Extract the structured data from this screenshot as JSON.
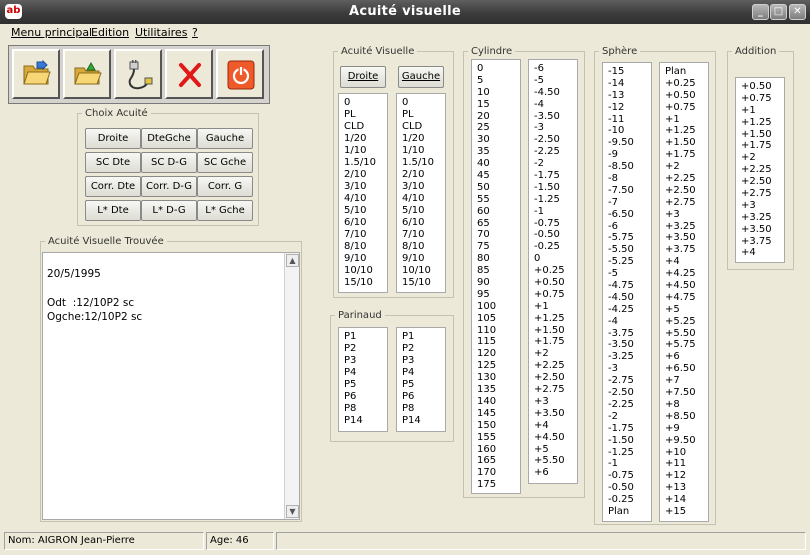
{
  "window": {
    "title": "Acuité visuelle",
    "app_icon_text": "ab"
  },
  "controls": {
    "minimize": "_",
    "maximize": "□",
    "close": "✕"
  },
  "menu": [
    "Menu principal",
    "Edition",
    "Utilitaires",
    "?"
  ],
  "toolbar": {
    "buttons": [
      {
        "name": "open-folder-button",
        "icon": "open-folder-icon"
      },
      {
        "name": "open-folder-2-button",
        "icon": "open-folder-green-icon"
      },
      {
        "name": "connect-device-button",
        "icon": "cable-plug-icon"
      },
      {
        "name": "delete-button",
        "icon": "red-x-icon"
      },
      {
        "name": "power-button",
        "icon": "power-icon"
      }
    ]
  },
  "choix_acuite": {
    "legend": "Choix Acuité",
    "buttons": [
      [
        "Droite",
        "DteGche",
        "Gauche"
      ],
      [
        "SC Dte",
        "SC D-G",
        "SC Gche"
      ],
      [
        "Corr. Dte",
        "Corr. D-G",
        "Corr. G"
      ],
      [
        "L* Dte",
        "L* D-G",
        "L* Gche"
      ]
    ]
  },
  "acuite_trouvee": {
    "legend": "Acuité Visuelle Trouvée",
    "text": "20/5/1995\n\nOdt  :12/10P2 sc\nOgche:12/10P2 sc"
  },
  "acuite_visuelle": {
    "legend": "Acuité Visuelle",
    "droite_label": "Droite",
    "gauche_label": "Gauche",
    "left_list": [
      "0",
      "PL",
      "CLD",
      "1/20",
      "1/10",
      "1.5/10",
      "2/10",
      "3/10",
      "4/10",
      "5/10",
      "6/10",
      "7/10",
      "8/10",
      "9/10",
      "10/10",
      "15/10"
    ],
    "right_list": [
      "0",
      "PL",
      "CLD",
      "1/20",
      "1/10",
      "1.5/10",
      "2/10",
      "3/10",
      "4/10",
      "5/10",
      "6/10",
      "7/10",
      "8/10",
      "9/10",
      "10/10",
      "15/10"
    ]
  },
  "parinaud": {
    "legend": "Parinaud",
    "left_list": [
      "P1",
      "P2",
      "P3",
      "P4",
      "P5",
      "P6",
      "P8",
      "P14"
    ],
    "right_list": [
      "P1",
      "P2",
      "P3",
      "P4",
      "P5",
      "P6",
      "P8",
      "P14"
    ]
  },
  "cylindre": {
    "legend": "Cylindre",
    "axis_list": [
      "0",
      "5",
      "10",
      "15",
      "20",
      "25",
      "30",
      "35",
      "40",
      "45",
      "50",
      "55",
      "60",
      "65",
      "70",
      "75",
      "80",
      "85",
      "90",
      "95",
      "100",
      "105",
      "110",
      "115",
      "120",
      "125",
      "130",
      "135",
      "140",
      "145",
      "150",
      "155",
      "160",
      "165",
      "170",
      "175"
    ],
    "power_list": [
      "-6",
      "-5",
      "-4.50",
      "-4",
      "-3.50",
      "-3",
      "-2.50",
      "-2.25",
      "-2",
      "-1.75",
      "-1.50",
      "-1.25",
      "-1",
      "-0.75",
      "-0.50",
      "-0.25",
      "0",
      "+0.25",
      "+0.50",
      "+0.75",
      "+1",
      "+1.25",
      "+1.50",
      "+1.75",
      "+2",
      "+2.25",
      "+2.50",
      "+2.75",
      "+3",
      "+3.50",
      "+4",
      "+4.50",
      "+5",
      "+5.50",
      "+6"
    ]
  },
  "sphere": {
    "legend": "Sphère",
    "minus_list": [
      "-15",
      "-14",
      "-13",
      "-12",
      "-11",
      "-10",
      "-9.50",
      "-9",
      "-8.50",
      "-8",
      "-7.50",
      "-7",
      "-6.50",
      "-6",
      "-5.75",
      "-5.50",
      "-5.25",
      "-5",
      "-4.75",
      "-4.50",
      "-4.25",
      "-4",
      "-3.75",
      "-3.50",
      "-3.25",
      "-3",
      "-2.75",
      "-2.50",
      "-2.25",
      "-2",
      "-1.75",
      "-1.50",
      "-1.25",
      "-1",
      "-0.75",
      "-0.50",
      "-0.25",
      "Plan"
    ],
    "plus_list": [
      "Plan",
      "+0.25",
      "+0.50",
      "+0.75",
      "+1",
      "+1.25",
      "+1.50",
      "+1.75",
      "+2",
      "+2.25",
      "+2.50",
      "+2.75",
      "+3",
      "+3.25",
      "+3.50",
      "+3.75",
      "+4",
      "+4.25",
      "+4.50",
      "+4.75",
      "+5",
      "+5.25",
      "+5.50",
      "+5.75",
      "+6",
      "+6.50",
      "+7",
      "+7.50",
      "+8",
      "+8.50",
      "+9",
      "+9.50",
      "+10",
      "+11",
      "+12",
      "+13",
      "+14",
      "+15"
    ]
  },
  "addition": {
    "legend": "Addition",
    "list": [
      "+0.50",
      "+0.75",
      "+1",
      "+1.25",
      "+1.50",
      "+1.75",
      "+2",
      "+2.25",
      "+2.50",
      "+2.75",
      "+3",
      "+3.25",
      "+3.50",
      "+3.75",
      "+4"
    ]
  },
  "status": {
    "nom": "Nom: AIGRON Jean-Pierre",
    "age": "Age: 46"
  }
}
